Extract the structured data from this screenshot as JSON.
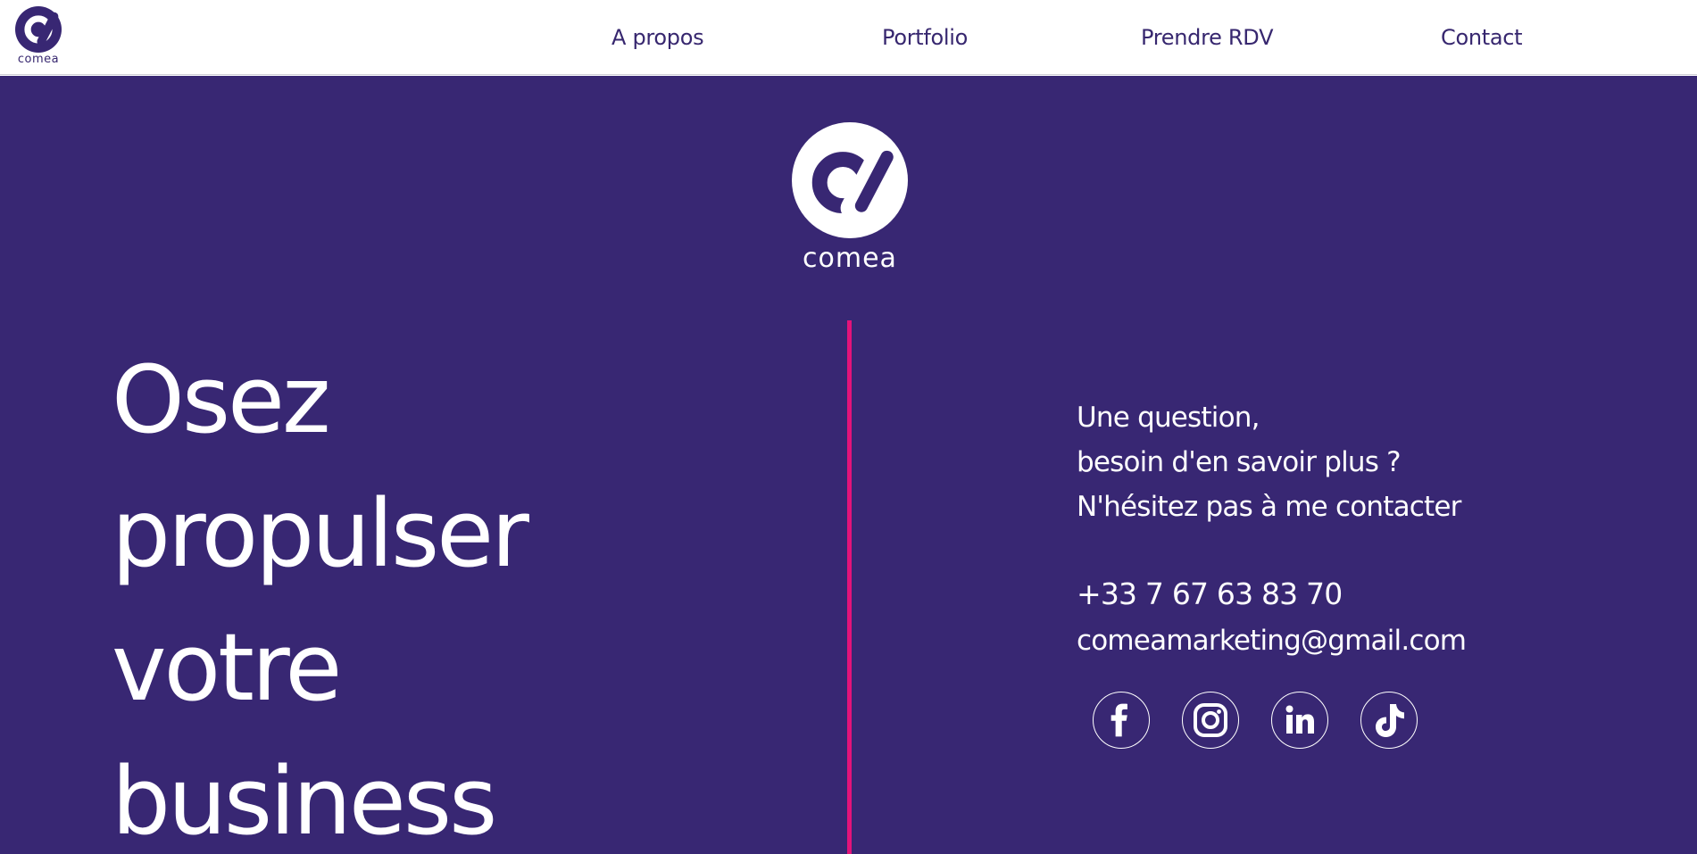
{
  "header": {
    "logo_text": "comea",
    "nav": [
      {
        "label": "A propos"
      },
      {
        "label": "Portfolio"
      },
      {
        "label": "Prendre RDV"
      },
      {
        "label": "Contact"
      }
    ]
  },
  "hero": {
    "logo_text": "comea",
    "slogan": [
      "Osez",
      "propulser",
      "votre",
      "business"
    ],
    "contact_intro": [
      "Une question,",
      "besoin d'en savoir plus ?",
      "N'hésitez pas à me contacter"
    ],
    "phone": "+33 7 67 63 83 70",
    "email": "comeamarketing@gmail.com",
    "socials": [
      {
        "icon": "facebook-icon"
      },
      {
        "icon": "instagram-icon"
      },
      {
        "icon": "linkedin-icon"
      },
      {
        "icon": "tiktok-icon"
      }
    ]
  },
  "colors": {
    "brand_purple": "#382773",
    "accent_pink": "#e3137a",
    "white": "#ffffff"
  }
}
